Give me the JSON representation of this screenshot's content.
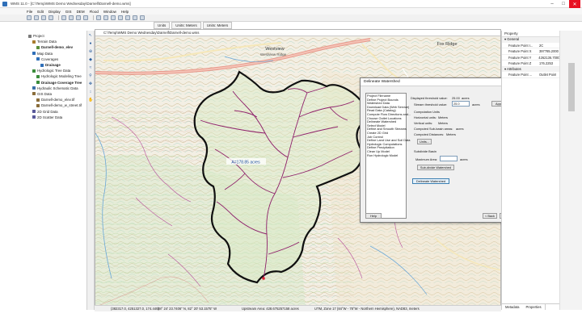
{
  "window": {
    "title": "WMS 11.0 - [C:\\Temp\\WMS Demo Wednesday\\Darnell\\Darnell-demo.wms]"
  },
  "menu": [
    "File",
    "Edit",
    "Display",
    "GIS",
    "DEM",
    "Flood",
    "Window",
    "Help"
  ],
  "module_tabs": [
    "Units",
    "Units: Meters",
    "Units: Meters"
  ],
  "map_window": {
    "title": "C:\\Temp\\WMS Demo Wednesday\\Darnell\\Darnell-demo.wms",
    "place_labels": [
      "Westview",
      "Westview Ridge",
      "Fox Ridge"
    ],
    "drainage_label": "A=178.85 acres"
  },
  "project_tree": [
    {
      "label": "Project",
      "color": "#7a7a7a",
      "indent": 0,
      "bold": false
    },
    {
      "label": "Terrain Data",
      "color": "#a87c2e",
      "indent": 1,
      "bold": false
    },
    {
      "label": "Darnell-demo_elev",
      "color": "#5a8f3a",
      "indent": 2,
      "bold": true
    },
    {
      "label": "Map Data",
      "color": "#2f6fb8",
      "indent": 1,
      "bold": false
    },
    {
      "label": "Coverages",
      "color": "#2f6fb8",
      "indent": 2,
      "bold": false
    },
    {
      "label": "Drainage",
      "color": "#2f6fb8",
      "indent": 3,
      "bold": true
    },
    {
      "label": "Hydrologic Tree Data",
      "color": "#3b8c3b",
      "indent": 1,
      "bold": false
    },
    {
      "label": "Hydrologic Modeling Tree",
      "color": "#3b8c3b",
      "indent": 2,
      "bold": false
    },
    {
      "label": "Drainage Coverage Tree",
      "color": "#3b8c3b",
      "indent": 2,
      "bold": true
    },
    {
      "label": "Hydraulic Schematic Data",
      "color": "#3b6fa8",
      "indent": 1,
      "bold": false
    },
    {
      "label": "GIS Data",
      "color": "#8a6d3b",
      "indent": 1,
      "bold": false
    },
    {
      "label": "Darnell-demo_elev.tif",
      "color": "#8a6d3b",
      "indent": 2,
      "bold": false
    },
    {
      "label": "Darnell-demo_w_street.tif",
      "color": "#8a6d3b",
      "indent": 2,
      "bold": false
    },
    {
      "label": "2D Grid Data",
      "color": "#5a5a9a",
      "indent": 1,
      "bold": false
    },
    {
      "label": "2D Scatter Data",
      "color": "#5a5a9a",
      "indent": 1,
      "bold": false
    }
  ],
  "dialog": {
    "title": "Delineate Watershed",
    "steps": [
      "Project Filename",
      "Define Project Bounds",
      "Watershed Data",
      "Download Data (Web Service)",
      "Read Data (Catalog)",
      "Compute Flow Directions and...",
      "Choose Outlet Locations",
      "Delineate Watershed",
      "Select Model",
      "Define and Smooth Streams",
      "Create 2D Grid",
      "Job Control",
      "Define Land Use and Soil Data",
      "Hydrologic Computations",
      "Define Precipitation",
      "Clean Up Model",
      "Run Hydrologic Model"
    ],
    "displayed_threshold_label": "Displayed threshold value:",
    "displayed_threshold_value": "25.00",
    "displayed_threshold_units": "acres",
    "stream_threshold_label": "Stream threshold value:",
    "stream_threshold_value": "25.0",
    "stream_threshold_units": "acres",
    "apply_button": "Apply to Display",
    "computation_units_heading": "Computation Units",
    "horizontal_units_label": "Horizontal units:",
    "horizontal_units_value": "Meters",
    "vertical_units_label": "Vertical units:",
    "vertical_units_value": "Meters",
    "subbasin_areas_label": "Computed Sub-basin areas:",
    "subbasin_areas_value": "acres",
    "distances_label": "Computed Distances:",
    "distances_value": "Meters",
    "units_button": "Units...",
    "subdivide_heading": "Subdivide Basin",
    "max_area_label": "Maximum Area:",
    "max_area_value": "",
    "max_area_units": "acres",
    "subdivide_button": "Sub-divide Watershed",
    "delineate_button": "Delineate Watershed",
    "help_button": "Help",
    "back_button": "< Back",
    "next_button": "Next >",
    "close_button": "Close"
  },
  "properties": {
    "header": "Property",
    "general_label": "General",
    "rows_general": [
      {
        "key": "Feature Point I...",
        "value": "2C"
      },
      {
        "key": "Feature Point X",
        "value": "397785.2000"
      },
      {
        "key": "Feature Point Y",
        "value": "4262136.7000"
      },
      {
        "key": "Feature Point Z",
        "value": "176.2253"
      }
    ],
    "attributes_label": "Attributes",
    "rows_attributes": [
      {
        "key": "Feature Point ...",
        "value": "Outlet Point"
      }
    ],
    "tabs": [
      "Metadata",
      "Properties"
    ]
  },
  "status": {
    "coords": "(382317.0, 4251327.0, 174.449)",
    "geo": "38° 24' 23.7406\" N, 82° 20' 53.1575\" W",
    "upstream_area": "Upstream Area: 428.675257158 acres",
    "utm": "UTM, Zone 17 (84°W - 78°W - Northern Hemisphere), NAD83, meters"
  }
}
